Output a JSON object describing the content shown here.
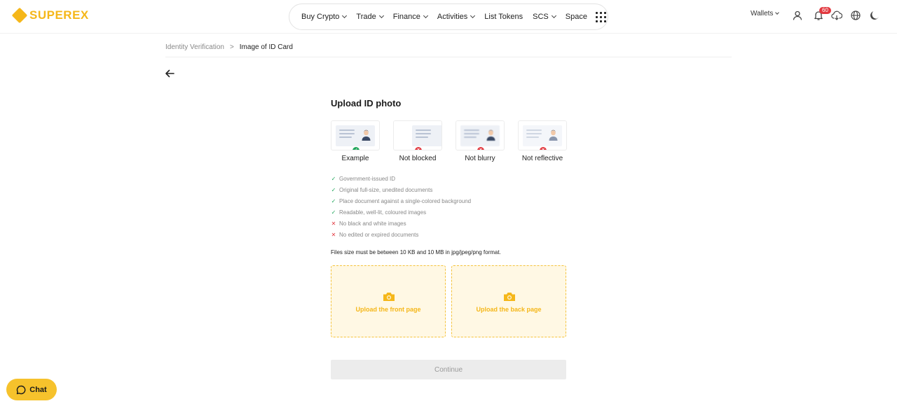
{
  "brand": {
    "name": "SUPEREX",
    "accent": "#f5b71a"
  },
  "nav": {
    "items": [
      {
        "label": "Buy Crypto",
        "dropdown": true
      },
      {
        "label": "Trade",
        "dropdown": true
      },
      {
        "label": "Finance",
        "dropdown": true
      },
      {
        "label": "Activities",
        "dropdown": true
      },
      {
        "label": "List Tokens",
        "dropdown": false
      },
      {
        "label": "SCS",
        "dropdown": true
      },
      {
        "label": "Space",
        "dropdown": false
      }
    ]
  },
  "toolbar": {
    "wallets_label": "Wallets",
    "notification_count": "60"
  },
  "breadcrumb": {
    "parent": "Identity Verification",
    "separator": ">",
    "current": "Image of ID Card"
  },
  "main": {
    "title": "Upload ID photo",
    "examples": [
      {
        "label": "Example",
        "status": "ok"
      },
      {
        "label": "Not blocked",
        "status": "bad"
      },
      {
        "label": "Not blurry",
        "status": "bad"
      },
      {
        "label": "Not reflective",
        "status": "bad"
      }
    ],
    "requirements": [
      {
        "text": "Government-issued ID",
        "allowed": true
      },
      {
        "text": "Original full-size, unedited documents",
        "allowed": true
      },
      {
        "text": "Place document against a single-colored background",
        "allowed": true
      },
      {
        "text": "Readable, well-lit, coloured images",
        "allowed": true
      },
      {
        "text": "No black and white images",
        "allowed": false
      },
      {
        "text": "No edited or expired documents",
        "allowed": false
      }
    ],
    "file_note": "Files size must be between 10 KB and 10 MB in jpg/jpeg/png format.",
    "upload_front": "Upload the front page",
    "upload_back": "Upload the back page",
    "continue_label": "Continue"
  },
  "chat": {
    "label": "Chat"
  }
}
